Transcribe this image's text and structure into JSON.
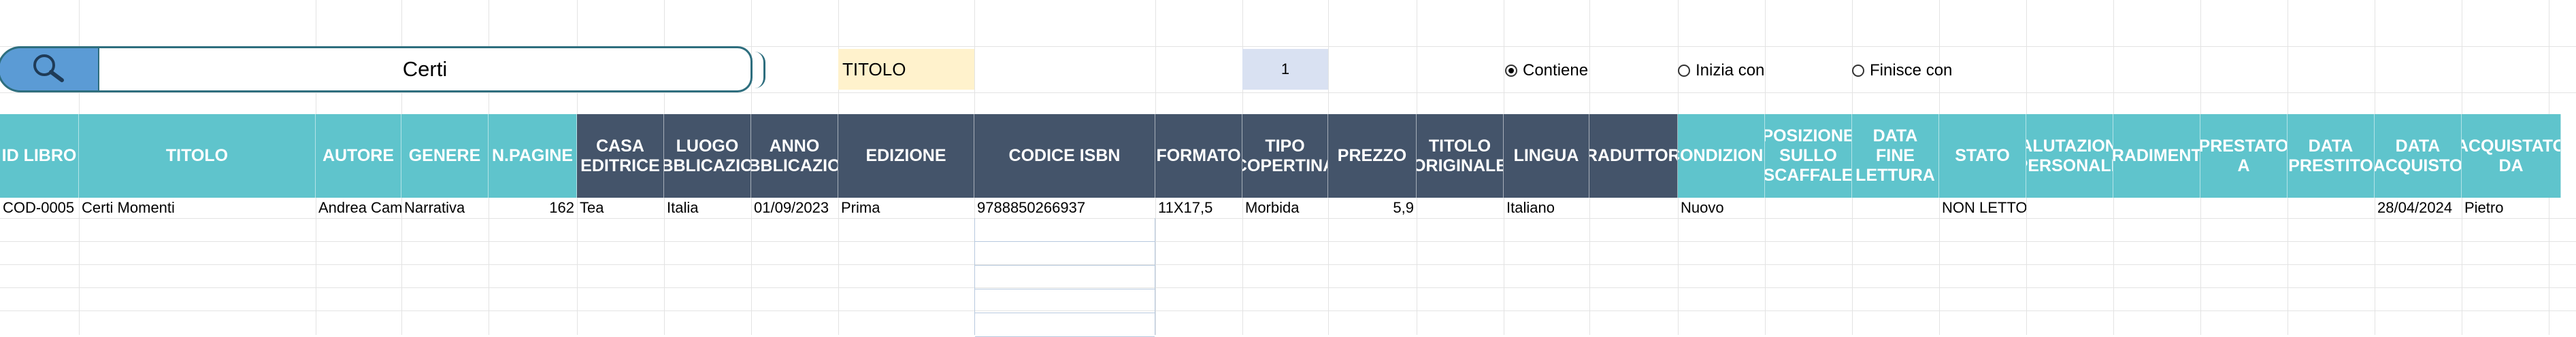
{
  "search": {
    "value": "Certi",
    "field": "TITOLO",
    "count": "1"
  },
  "radios": [
    {
      "label": "Contiene",
      "selected": true
    },
    {
      "label": "Inizia con",
      "selected": false
    },
    {
      "label": "Finisce con",
      "selected": false
    }
  ],
  "headers": [
    "ID LIBRO",
    "TITOLO",
    "AUTORE",
    "GENERE",
    "N.PAGINE",
    "CASA EDITRICE",
    "LUOGO PUBBLICAZIONE",
    "ANNO PUBBLICAZIONE",
    "EDIZIONE",
    "CODICE ISBN",
    "FORMATO",
    "TIPO COPERTINA",
    "PREZZO",
    "TITOLO ORIGINALE",
    "LINGUA",
    "TRADUTTORE",
    "CONDIZIONE",
    "POSIZIONE SULLO SCAFFALE",
    "DATA FINE LETTURA",
    "STATO",
    "VALUTAZIONE PERSONALE",
    "GRADIMENTO",
    "PRESTATO A",
    "DATA PRESTITO",
    "DATA ACQUISTO",
    "ACQUISTATO DA"
  ],
  "row": [
    "COD-0005",
    "Certi Momenti",
    "Andrea Cami",
    "Narrativa",
    "162",
    "Tea",
    "Italia",
    "01/09/2023",
    "Prima",
    "9788850266937",
    "11X17,5",
    "Morbida",
    "5,9",
    "",
    "Italiano",
    "",
    "Nuovo",
    "",
    "",
    "NON LETTO",
    "",
    "",
    "",
    "",
    "28/04/2024",
    "Pietro"
  ],
  "colors": {
    "teal": "#5fc4cc",
    "navy": "#44546a",
    "field_bg": "#fff2cc",
    "count_bg": "#d9e1f2",
    "search_btn": "#5b9bd5"
  }
}
